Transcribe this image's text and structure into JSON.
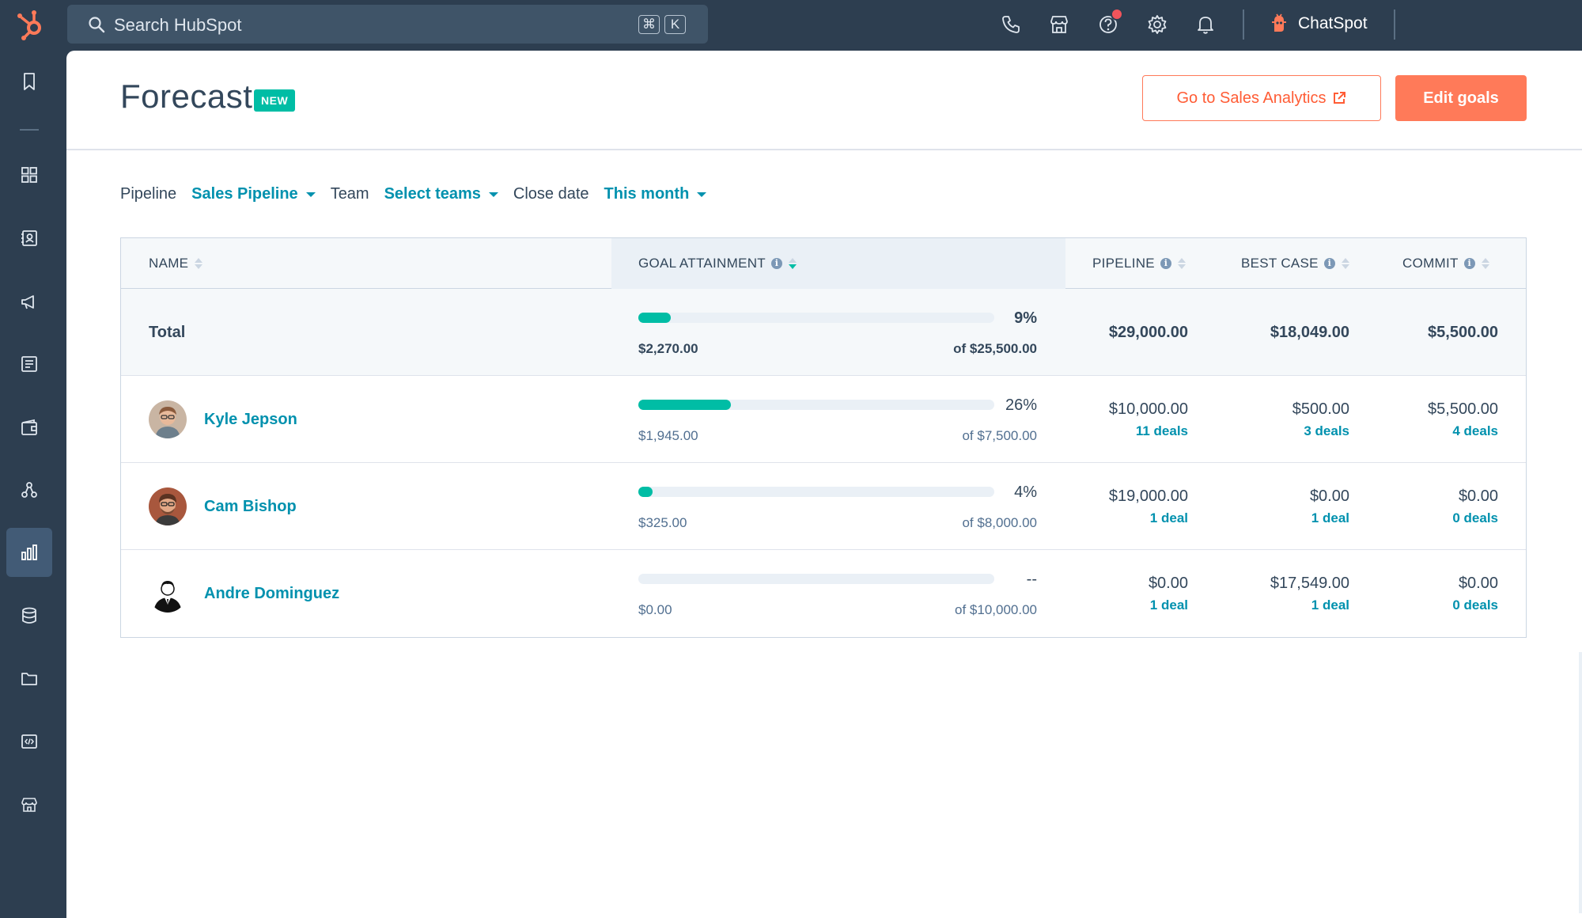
{
  "topbar": {
    "search_placeholder": "Search HubSpot",
    "kbd_cmd": "⌘",
    "kbd_k": "K",
    "chatspot_label": "ChatSpot",
    "icons": [
      "phone-icon",
      "marketplace-icon",
      "help-icon",
      "settings-icon",
      "notifications-icon"
    ]
  },
  "sidenav": {
    "items": [
      "bookmark-icon",
      "dashboard-icon",
      "contacts-icon",
      "marketing-icon",
      "content-icon",
      "commerce-icon",
      "automation-icon",
      "reporting-icon",
      "data-icon",
      "library-icon",
      "development-icon",
      "marketplace-icon"
    ],
    "active": "reporting-icon"
  },
  "header": {
    "title": "Forecast",
    "badge": "NEW",
    "analytics_button": "Go to Sales Analytics",
    "edit_button": "Edit goals"
  },
  "filters": {
    "pipeline_label": "Pipeline",
    "pipeline_value": "Sales Pipeline",
    "team_label": "Team",
    "team_value": "Select teams",
    "close_label": "Close date",
    "close_value": "This month"
  },
  "table": {
    "columns": {
      "name": "NAME",
      "goal": "GOAL ATTAINMENT",
      "pipeline": "PIPELINE",
      "best": "BEST CASE",
      "commit": "COMMIT"
    },
    "total": {
      "name": "Total",
      "progress": 0.09,
      "pct": "9%",
      "attained": "$2,270.00",
      "goal": "of $25,500.00",
      "pipeline": "$29,000.00",
      "best": "$18,049.00",
      "commit": "$5,500.00"
    },
    "rows": [
      {
        "name": "Kyle Jepson",
        "progress": 0.26,
        "pct": "26%",
        "attained": "$1,945.00",
        "goal": "of $7,500.00",
        "pipeline": "$10,000.00",
        "pipeline_deals": "11 deals",
        "best": "$500.00",
        "best_deals": "3 deals",
        "commit": "$5,500.00",
        "commit_deals": "4 deals"
      },
      {
        "name": "Cam Bishop",
        "progress": 0.04,
        "pct": "4%",
        "attained": "$325.00",
        "goal": "of $8,000.00",
        "pipeline": "$19,000.00",
        "pipeline_deals": "1 deal",
        "best": "$0.00",
        "best_deals": "1 deal",
        "commit": "$0.00",
        "commit_deals": "0 deals"
      },
      {
        "name": "Andre Dominguez",
        "progress": 0,
        "pct": "--",
        "attained": "$0.00",
        "goal": "of $10,000.00",
        "pipeline": "$0.00",
        "pipeline_deals": "1 deal",
        "best": "$17,549.00",
        "best_deals": "1 deal",
        "commit": "$0.00",
        "commit_deals": "0 deals"
      }
    ]
  },
  "colors": {
    "brand_orange": "#ff7a59",
    "teal": "#00bda5",
    "link": "#0091ae",
    "nav_bg": "#2d3e50"
  }
}
